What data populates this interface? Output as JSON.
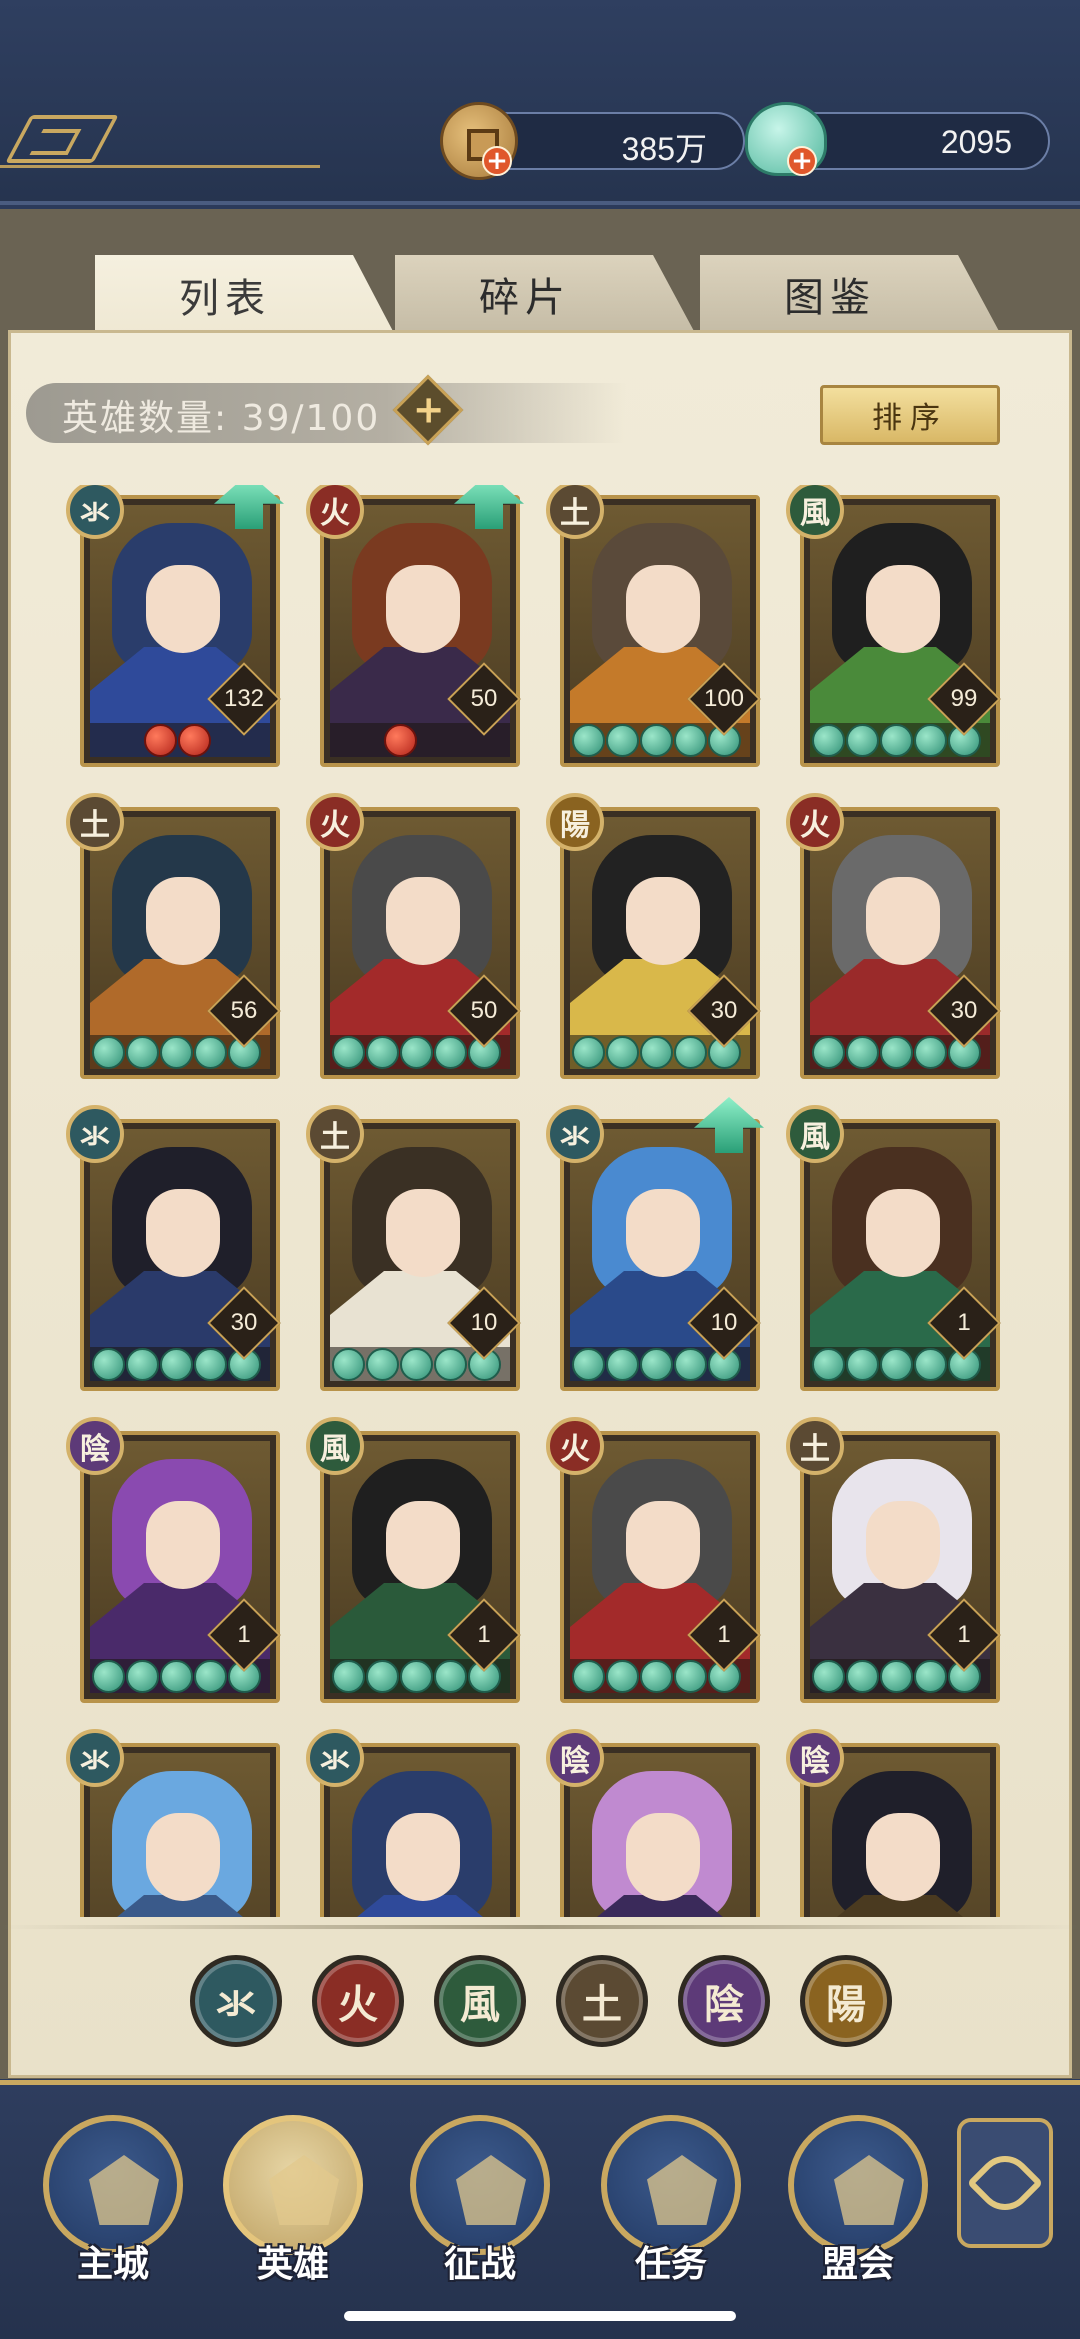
{
  "currencies": [
    {
      "name": "coin",
      "value": "385万"
    },
    {
      "name": "jade",
      "value": "2095"
    }
  ],
  "tabs": [
    {
      "label": "列表",
      "active": true
    },
    {
      "label": "碎片",
      "active": false
    },
    {
      "label": "图鉴",
      "active": false
    }
  ],
  "hero_count": {
    "label": "英雄数量: 39/100",
    "plus": "+"
  },
  "sort_label": "排序",
  "element_glyphs": {
    "water": "氺",
    "fire": "火",
    "wind": "風",
    "earth": "土",
    "yin": "陰",
    "yang": "陽"
  },
  "element_colors": {
    "water": "#2e5960",
    "fire": "#8a2d25",
    "wind": "#2e5b3c",
    "earth": "#5b4a33",
    "yin": "#5d3a78",
    "yang": "#8a6320"
  },
  "heroes": [
    {
      "element": "water",
      "level": "132",
      "stars": 2,
      "star_color": "red",
      "upgrade": true,
      "hair": "#2a3d6b",
      "robe": "#2f4a9a"
    },
    {
      "element": "fire",
      "level": "50",
      "stars": 1,
      "star_color": "red",
      "upgrade": true,
      "hair": "#7a3a20",
      "robe": "#3a2a4a"
    },
    {
      "element": "earth",
      "level": "100",
      "stars": 5,
      "star_color": "jade",
      "upgrade": false,
      "hair": "#5a4a3a",
      "robe": "#c47a2a"
    },
    {
      "element": "wind",
      "level": "99",
      "stars": 5,
      "star_color": "jade",
      "upgrade": false,
      "hair": "#1f1f1f",
      "robe": "#4a8a3a"
    },
    {
      "element": "earth",
      "level": "56",
      "stars": 5,
      "star_color": "jade",
      "upgrade": false,
      "hair": "#24384a",
      "robe": "#b06a2a"
    },
    {
      "element": "fire",
      "level": "50",
      "stars": 5,
      "star_color": "jade",
      "upgrade": false,
      "hair": "#4a4a4a",
      "robe": "#a32a2a"
    },
    {
      "element": "yang",
      "level": "30",
      "stars": 5,
      "star_color": "jade",
      "upgrade": false,
      "hair": "#222222",
      "robe": "#d9b84a"
    },
    {
      "element": "fire",
      "level": "30",
      "stars": 5,
      "star_color": "jade",
      "upgrade": false,
      "hair": "#6a6a6a",
      "robe": "#9a2a2a"
    },
    {
      "element": "water",
      "level": "30",
      "stars": 5,
      "star_color": "jade",
      "upgrade": false,
      "hair": "#1f1f2a",
      "robe": "#2a3a6a"
    },
    {
      "element": "earth",
      "level": "10",
      "stars": 5,
      "star_color": "jade",
      "upgrade": false,
      "hair": "#3a3024",
      "robe": "#e8e2d2"
    },
    {
      "element": "water",
      "level": "10",
      "stars": 5,
      "star_color": "jade",
      "upgrade": true,
      "hair": "#4a8ad0",
      "robe": "#2a4a8a"
    },
    {
      "element": "wind",
      "level": "1",
      "stars": 5,
      "star_color": "jade",
      "upgrade": false,
      "hair": "#4a3020",
      "robe": "#2a6a4a"
    },
    {
      "element": "yin",
      "level": "1",
      "stars": 5,
      "star_color": "jade",
      "upgrade": false,
      "hair": "#8a4ab0",
      "robe": "#4a2a6a"
    },
    {
      "element": "wind",
      "level": "1",
      "stars": 5,
      "star_color": "jade",
      "upgrade": false,
      "hair": "#1f1f1f",
      "robe": "#2a5a3a"
    },
    {
      "element": "fire",
      "level": "1",
      "stars": 5,
      "star_color": "jade",
      "upgrade": false,
      "hair": "#4a4a4a",
      "robe": "#a32a2a"
    },
    {
      "element": "earth",
      "level": "1",
      "stars": 5,
      "star_color": "jade",
      "upgrade": false,
      "hair": "#e8e4ec",
      "robe": "#3a3040"
    },
    {
      "element": "water",
      "level": "",
      "stars": 0,
      "star_color": "jade",
      "upgrade": false,
      "hair": "#6aa8e0",
      "robe": "#3a5a8a"
    },
    {
      "element": "water",
      "level": "",
      "stars": 0,
      "star_color": "jade",
      "upgrade": false,
      "hair": "#2a3d6b",
      "robe": "#2f4a9a"
    },
    {
      "element": "yin",
      "level": "",
      "stars": 0,
      "star_color": "jade",
      "upgrade": false,
      "hair": "#c08ad0",
      "robe": "#3a2a5a"
    },
    {
      "element": "yin",
      "level": "",
      "stars": 0,
      "star_color": "jade",
      "upgrade": false,
      "hair": "#1f1f2a",
      "robe": "#4a3a20"
    }
  ],
  "filters": [
    "water",
    "fire",
    "wind",
    "earth",
    "yin",
    "yang"
  ],
  "bottom_nav": [
    {
      "label": "主城",
      "name": "main-city",
      "active": false
    },
    {
      "label": "英雄",
      "name": "heroes",
      "active": true
    },
    {
      "label": "征战",
      "name": "campaign",
      "active": false
    },
    {
      "label": "任务",
      "name": "quests",
      "active": false
    },
    {
      "label": "盟会",
      "name": "guild",
      "active": false
    }
  ],
  "more_icon": "flower-icon"
}
